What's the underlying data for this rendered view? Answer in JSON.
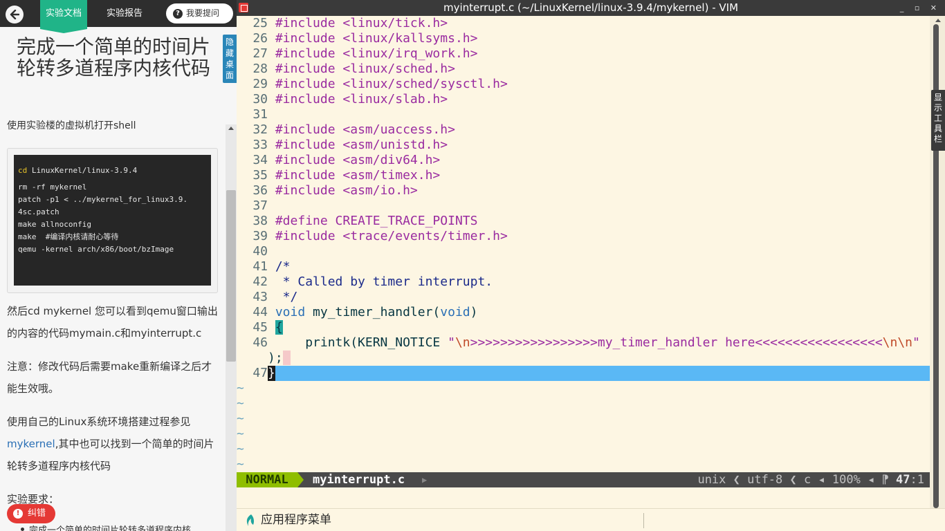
{
  "docs_panel": {
    "tabs": {
      "doc": "实验文档",
      "report": "实验报告"
    },
    "ask_button": "我要提问",
    "ask_icon_glyph": "?",
    "title": "完成一个简单的时间片轮转多道程序内核代码",
    "hide_desktop": "隐藏桌面",
    "intro_line": "使用实验楼的虚拟机打开shell",
    "code_lines": [
      "cd LinuxKernel/linux-3.9.4",
      "rm -rf mykernel",
      "patch -p1 < ../mykernel_for_linux3.9.",
      "4sc.patch",
      "make allnoconfig",
      "make  #编译内核请耐心等待",
      "qemu -kernel arch/x86/boot/bzImage"
    ],
    "para1": "然后cd mykernel 您可以看到qemu窗口输出的内容的代码mymain.c和myinterrupt.c",
    "para2": "注意：修改代码后需要make重新编译之后才能生效哦。",
    "para3_pre": "使用自己的Linux系统环境搭建过程参见",
    "para3_link": "mykernel",
    "para3_post": ",其中也可以找到一个简单的时间片轮转多道程序内核代码",
    "para4": "实验要求：",
    "correct_button": "纠错",
    "bullet_partial": "完成一个简单的时间片轮转多道程序内核",
    "colors": {
      "tab_active": "#20b488",
      "topbar": "#2e2e2e",
      "link": "#2a6fb5",
      "correct": "#e53935"
    }
  },
  "vim": {
    "window_title": "myinterrupt.c (~/LinuxKernel/linux-3.9.4/mykernel) - VIM",
    "window_controls": "_ ▫ ✕",
    "lines": [
      {
        "n": "25",
        "pre": "#include ",
        "hdr": "<linux/tick.h>"
      },
      {
        "n": "26",
        "pre": "#include ",
        "hdr": "<linux/kallsyms.h>"
      },
      {
        "n": "27",
        "pre": "#include ",
        "hdr": "<linux/irq_work.h>"
      },
      {
        "n": "28",
        "pre": "#include ",
        "hdr": "<linux/sched.h>"
      },
      {
        "n": "29",
        "pre": "#include ",
        "hdr": "<linux/sched/sysctl.h>"
      },
      {
        "n": "30",
        "pre": "#include ",
        "hdr": "<linux/slab.h>"
      },
      {
        "n": "31",
        "pre": "",
        "hdr": ""
      },
      {
        "n": "32",
        "pre": "#include ",
        "hdr": "<asm/uaccess.h>"
      },
      {
        "n": "33",
        "pre": "#include ",
        "hdr": "<asm/unistd.h>"
      },
      {
        "n": "34",
        "pre": "#include ",
        "hdr": "<asm/div64.h>"
      },
      {
        "n": "35",
        "pre": "#include ",
        "hdr": "<asm/timex.h>"
      },
      {
        "n": "36",
        "pre": "#include ",
        "hdr": "<asm/io.h>"
      },
      {
        "n": "37",
        "pre": "",
        "hdr": ""
      },
      {
        "n": "38",
        "pre": "#define ",
        "hdr": "CREATE_TRACE_POINTS"
      },
      {
        "n": "39",
        "pre": "#include ",
        "hdr": "<trace/events/timer.h>"
      },
      {
        "n": "40",
        "pre": "",
        "hdr": ""
      },
      {
        "n": "41",
        "comment": "/*"
      },
      {
        "n": "42",
        "comment": " * Called by timer interrupt."
      },
      {
        "n": "43",
        "comment": " */"
      }
    ],
    "line44": {
      "n": "44",
      "type": "void",
      "fn": " my_timer_handler(",
      "arg": "void",
      "close": ")"
    },
    "line45": {
      "n": "45",
      "brace": "{"
    },
    "line46": {
      "n": "46",
      "indent": "    printk(KERN_NOTICE ",
      "q1": "\"",
      "esc1": "\\n",
      "mid": ">>>>>>>>>>>>>>>>>my_timer_handler here<<<<<<<<<<<<<<<<<",
      "esc2": "\\n\\n",
      "q2": "\"",
      "wrap": ");"
    },
    "line47": {
      "n": "47",
      "brace": "}"
    },
    "tilde": "~",
    "statusline": {
      "mode": "NORMAL",
      "file": "myinterrupt.c",
      "right_info": "unix ❮ utf-8 ❮ c ◂ 100% ◂ ⁋ ",
      "position": "47",
      "column": ":1"
    },
    "show_toolbar": "显示工具栏",
    "colors": {
      "background": "#fdf6e3",
      "mode": "#8fbe00",
      "current_line": "#5ab8f5",
      "preproc": "#9a2ba0",
      "type": "#2a6fb5",
      "comment": "#1b2a8a"
    }
  },
  "taskbar": {
    "menu_label": "应用程序菜单"
  }
}
